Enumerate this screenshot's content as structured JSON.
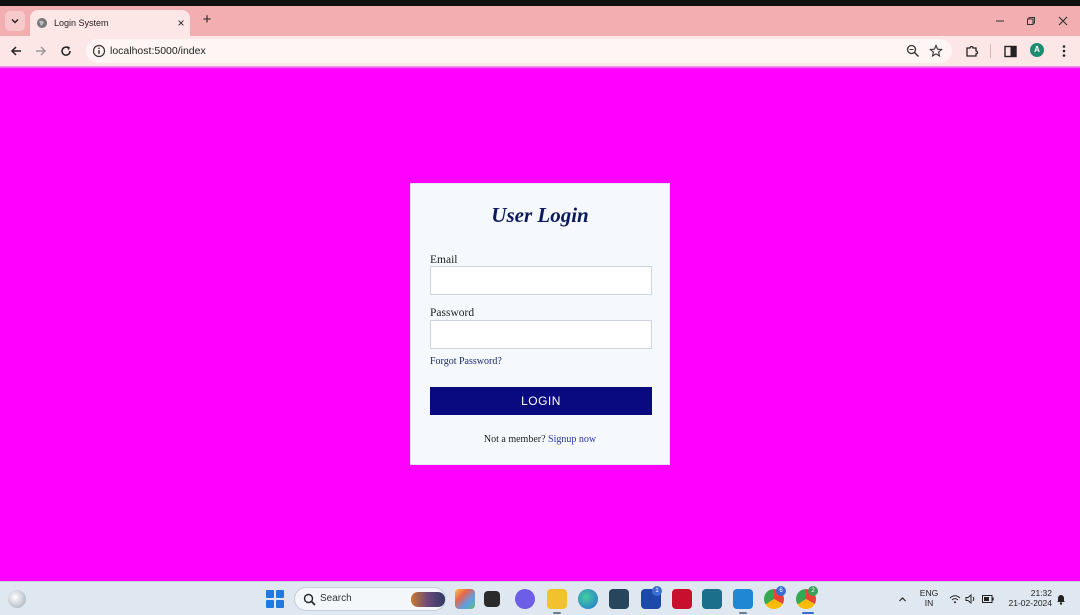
{
  "browser": {
    "tab_title": "Login System",
    "url": "localhost:5000/index",
    "profile_initial": "A",
    "icons": {
      "tab_list": "chevron-down-icon",
      "tab_favicon": "globe-icon",
      "tab_close": "close-icon",
      "new_tab": "plus-icon",
      "back": "arrow-left-icon",
      "forward": "arrow-right-icon",
      "reload": "reload-icon",
      "site_info": "info-icon",
      "zoom": "zoom-icon",
      "bookmark": "star-icon",
      "extensions": "puzzle-icon",
      "side_panel": "side-panel-icon",
      "menu": "kebab-menu-icon"
    },
    "new_tab_symbol": "+",
    "close_symbol": "×"
  },
  "login": {
    "title": "User Login",
    "email_label": "Email",
    "email_value": "",
    "password_label": "Password",
    "password_value": "",
    "forgot_link": "Forgot Password?",
    "login_button": "LOGIN",
    "member_text": "Not a member?",
    "signup_link": "Signup now"
  },
  "taskbar": {
    "search_placeholder": "Search",
    "language_line1": "ENG",
    "language_line2": "IN",
    "time": "21:32",
    "date": "21-02-2024",
    "badges": {
      "store": "1",
      "chrome_a": "6",
      "chrome_b": "2"
    }
  },
  "colors": {
    "page_background": "#ff00ff",
    "tab_bar": "#f2aeb0",
    "toolbar": "#fde6e6",
    "card_background": "#f5f8fc",
    "title_color": "#0d1a5c",
    "button_background": "#0a0a80",
    "button_text": "#ffffff",
    "link_color": "#2a3aa6",
    "taskbar": "#dfe8f0"
  }
}
